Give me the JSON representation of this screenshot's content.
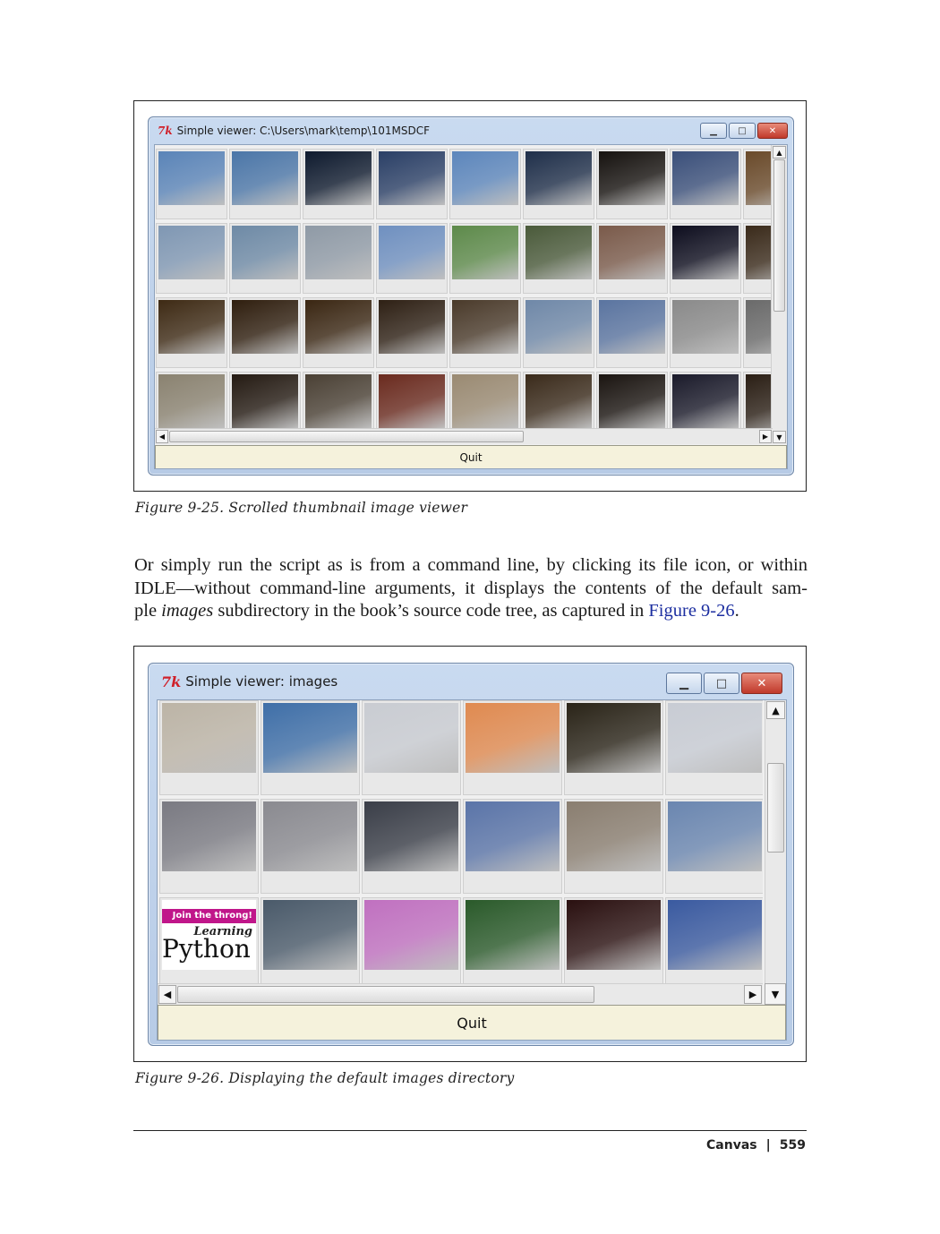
{
  "figure1": {
    "window_title": "Simple viewer: C:\\Users\\mark\\temp\\101MSDCF",
    "quit_label": "Quit",
    "caption": "Figure 9-25. Scrolled thumbnail image viewer",
    "thumbnails": [
      [
        "#5a84b8",
        "#4b76a8",
        "#0e1a2e",
        "#2a3f66",
        "#5c86bc",
        "#1f2f4a",
        "#16120f",
        "#3a4f7a",
        "#6a4a2a"
      ],
      [
        "#7f97b3",
        "#6e8aa6",
        "#8f9aa6",
        "#6f90c0",
        "#5d8a4a",
        "#4a5a3a",
        "#7a5a4a",
        "#0d0d1e",
        "#3a2a1a"
      ],
      [
        "#3e2a14",
        "#2f1e0e",
        "#3a2612",
        "#2e2014",
        "#4a3a2a",
        "#6f88a8",
        "#5a74a0",
        "#8a8a8a",
        "#6a6a6a"
      ],
      [
        "#8a8270",
        "#241a12",
        "#4a4034",
        "#6a2a1e",
        "#9a8a72",
        "#3a2a1a",
        "#1a1410",
        "#1a1a2a",
        "#2a1e14"
      ]
    ]
  },
  "paragraph": {
    "line1": "Or simply run the script as is from a command line, by clicking its file icon, or within",
    "line2": "IDLE—without command-line arguments, it displays the contents of the default sam-",
    "line3_pre": "ple ",
    "line3_em": "images",
    "line3_mid": " subdirectory in the book’s source code tree, as captured in ",
    "line3_link": "Figure 9-26",
    "line3_post": "."
  },
  "figure2": {
    "window_title": "Simple viewer: images",
    "quit_label": "Quit",
    "caption": "Figure 9-26. Displaying the default images directory",
    "thumbnails": [
      [
        "#bcb4a6",
        "#3f6fa8",
        "#c9ccd2",
        "#e08a50",
        "#2a2418",
        "#c8ccd4"
      ],
      [
        "#7a7a82",
        "#8a8a90",
        "#3a3e48",
        "#5a74a8",
        "#8a7e70",
        "#6a86b0"
      ],
      [
        "#b8b8b8",
        "#4a5a6a",
        "#c070c0",
        "#2a5a2a",
        "#2a1010",
        "#3a5aa0"
      ]
    ],
    "learning_python_badge": "Join the throng!",
    "learning_python_title1": "Learning",
    "learning_python_title2": "Python"
  },
  "footer": {
    "section": "Canvas",
    "separator": "|",
    "page_number": "559"
  }
}
